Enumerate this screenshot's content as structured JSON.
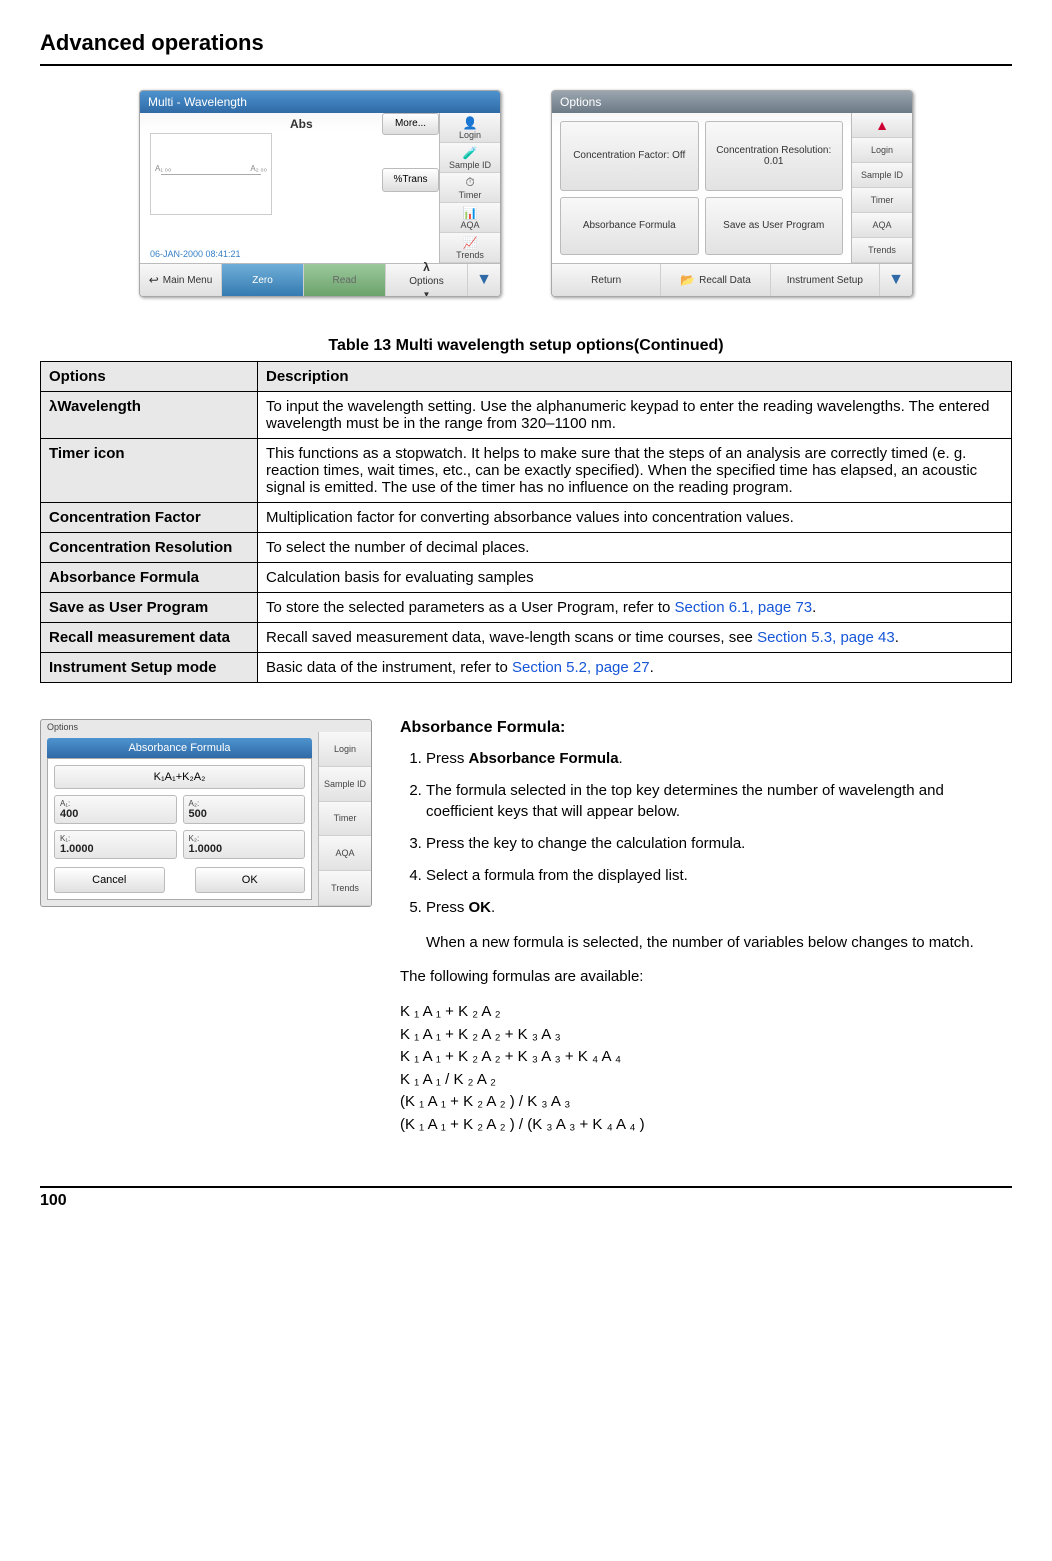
{
  "header": {
    "title": "Advanced operations",
    "page_number": "100"
  },
  "screenshots": {
    "left": {
      "title": "Multi - Wavelength",
      "abs_label": "Abs",
      "more_label": "More...",
      "trans_label": "%Trans",
      "axis_left": "A₁ ₀₀",
      "axis_right": "A₂ ₀₀",
      "date": "06-JAN-2000  08:41:21",
      "bottom": {
        "main_menu": "Main Menu",
        "zero": "Zero",
        "read": "Read",
        "options": "Options",
        "lambda": "λ"
      }
    },
    "right": {
      "title": "Options",
      "cells": {
        "c1": "Concentration Factor: Off",
        "c2": "Concentration Resolution: 0.01",
        "c3": "Absorbance Formula",
        "c4": "Save as User Program"
      },
      "bottom": {
        "return": "Return",
        "recall": "Recall Data",
        "instr": "Instrument Setup"
      }
    },
    "side": {
      "login": "Login",
      "sample": "Sample ID",
      "timer": "Timer",
      "aqa": "AQA",
      "trends": "Trends"
    }
  },
  "table": {
    "caption": "Table 13 Multi wavelength setup options(Continued)",
    "head": {
      "options": "Options",
      "description": "Description"
    },
    "rows": [
      {
        "name": "λWavelength",
        "desc": "To input the wavelength setting. Use the alphanumeric keypad to enter the reading wavelengths. The entered wavelength must be in the range from 320–1100 nm."
      },
      {
        "name": "Timer icon",
        "desc": "This functions as a stopwatch. It helps to make sure that the steps of an analysis are correctly timed (e. g. reaction times, wait times, etc., can be exactly specified). When the specified time has elapsed, an acoustic signal is emitted. The use of the timer has no influence on the reading program."
      },
      {
        "name": "Concentration Factor",
        "desc": "Multiplication factor for converting absorbance values into concentration values."
      },
      {
        "name": "Concentration Resolution",
        "desc": "To select the number of decimal places."
      },
      {
        "name": "Absorbance Formula",
        "desc": "Calculation basis for evaluating samples"
      },
      {
        "name": "Save as User Program",
        "desc_prefix": "To store the selected parameters as a User Program, refer to ",
        "link": "Section 6.1, page 73",
        "desc_suffix": "."
      },
      {
        "name": "Recall measurement data",
        "desc_prefix": "Recall saved measurement data, wave-length scans or time courses, see ",
        "link": "Section 5.3, page 43",
        "desc_suffix": "."
      },
      {
        "name": "Instrument Setup mode",
        "desc_prefix": "Basic data of the instrument, refer to ",
        "link": "Section 5.2, page 27",
        "desc_suffix": "."
      }
    ]
  },
  "dialog": {
    "tag": "Options",
    "title": "Absorbance Formula",
    "formula": "K₁A₁+K₂A₂",
    "cells": {
      "a1_label": "A₁:",
      "a1_val": "400",
      "a2_label": "A₂:",
      "a2_val": "500",
      "k1_label": "K₁:",
      "k1_val": "1.0000",
      "k2_label": "K₂:",
      "k2_val": "1.0000"
    },
    "cancel": "Cancel",
    "ok": "OK"
  },
  "procedure": {
    "heading": "Absorbance Formula:",
    "s1a": "Press ",
    "s1b": "Absorbance Formula",
    "s1c": ".",
    "s2": "The formula selected in the top key determines the number of wavelength and coefficient keys that will appear below.",
    "s3": "Press the key to change the calculation formula.",
    "s4": "Select a formula from the displayed list.",
    "s5a": "Press ",
    "s5b": "OK",
    "s5c": ".",
    "post_ok": "When a new formula is selected, the number of variables below changes to match.",
    "available": "The following formulas are available:",
    "formulas": [
      "K ₁ A ₁ + K ₂ A ₂",
      "K ₁ A ₁ + K ₂ A ₂ + K ₃ A ₃",
      "K ₁ A ₁ + K ₂ A ₂ + K ₃ A ₃ + K ₄ A ₄",
      "K ₁ A ₁ / K ₂ A ₂",
      "(K ₁ A ₁ + K ₂ A ₂ ) / K ₃ A ₃",
      "(K ₁ A ₁ + K ₂ A ₂ ) / (K ₃ A ₃ + K ₄ A ₄ )"
    ]
  }
}
